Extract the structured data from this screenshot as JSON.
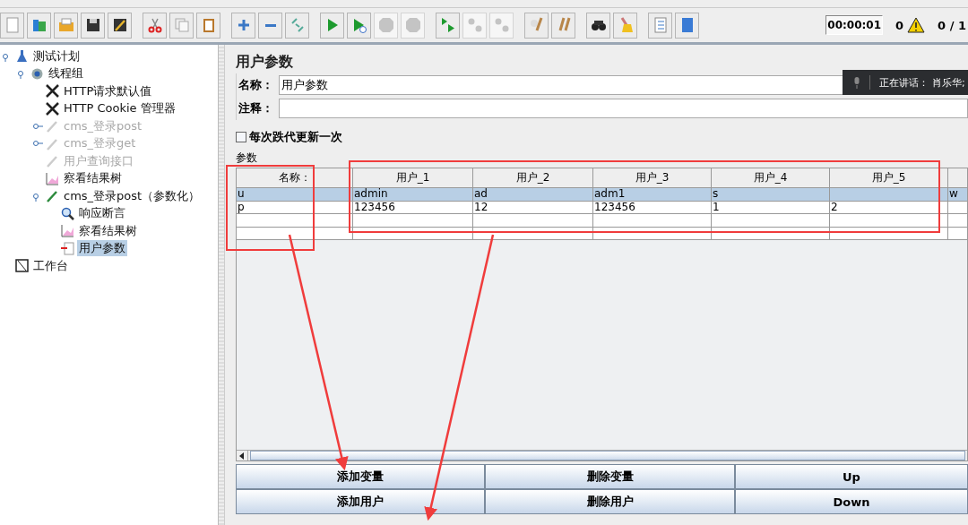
{
  "toolbar": {
    "groups": [
      [
        {
          "kind": "new",
          "disabled": false
        },
        {
          "kind": "templates",
          "disabled": false
        },
        {
          "kind": "open",
          "disabled": false
        },
        {
          "kind": "save",
          "disabled": false
        },
        {
          "kind": "save-as",
          "disabled": false
        }
      ],
      [
        {
          "kind": "cut",
          "disabled": false
        },
        {
          "kind": "copy",
          "disabled": false
        },
        {
          "kind": "paste",
          "disabled": false
        }
      ],
      [
        {
          "kind": "plus",
          "disabled": false
        },
        {
          "kind": "minus",
          "disabled": false
        },
        {
          "kind": "toggle",
          "disabled": false
        }
      ],
      [
        {
          "kind": "start",
          "disabled": false
        },
        {
          "kind": "start-no-pause",
          "disabled": false
        },
        {
          "kind": "stop",
          "disabled": true
        },
        {
          "kind": "shutdown",
          "disabled": true
        }
      ],
      [
        {
          "kind": "remote-start",
          "disabled": false
        },
        {
          "kind": "remote-stop",
          "disabled": true
        },
        {
          "kind": "remote-shutdown",
          "disabled": true
        }
      ],
      [
        {
          "kind": "clear",
          "disabled": false
        },
        {
          "kind": "clear-all",
          "disabled": false
        }
      ],
      [
        {
          "kind": "search",
          "disabled": false
        },
        {
          "kind": "reset-search",
          "disabled": false
        }
      ],
      [
        {
          "kind": "functions",
          "disabled": false
        },
        {
          "kind": "help",
          "disabled": false
        }
      ]
    ],
    "timer": "00:00:01",
    "warnings": "0",
    "threads": "0 / 1"
  },
  "tree": [
    {
      "label": "测试计划",
      "kind": "plan",
      "disabled": false,
      "selected": false,
      "expanded": true,
      "children": [
        {
          "label": "线程组",
          "kind": "gear",
          "disabled": false,
          "selected": false,
          "expanded": true,
          "children": [
            {
              "label": "HTTP请求默认值",
              "kind": "tools",
              "disabled": false,
              "selected": false
            },
            {
              "label": "HTTP Cookie 管理器",
              "kind": "tools",
              "disabled": false,
              "selected": false
            },
            {
              "label": "cms_登录post",
              "kind": "pipette",
              "disabled": true,
              "selected": false,
              "expanded": false
            },
            {
              "label": "cms_登录get",
              "kind": "pipette",
              "disabled": true,
              "selected": false,
              "expanded": false
            },
            {
              "label": "用户查询接口",
              "kind": "pipette",
              "disabled": true,
              "selected": false
            },
            {
              "label": "察看结果树",
              "kind": "graph",
              "disabled": false,
              "selected": false
            },
            {
              "label": "cms_登录post（参数化）",
              "kind": "pipette",
              "disabled": false,
              "selected": false,
              "expanded": true,
              "children": [
                {
                  "label": "响应断言",
                  "kind": "magnifier",
                  "disabled": false,
                  "selected": false
                },
                {
                  "label": "察看结果树",
                  "kind": "graph",
                  "disabled": false,
                  "selected": false
                },
                {
                  "label": "用户参数",
                  "kind": "doc",
                  "disabled": false,
                  "selected": true
                }
              ]
            }
          ]
        }
      ]
    },
    {
      "label": "工作台",
      "kind": "workbench",
      "disabled": false,
      "selected": false
    }
  ],
  "panel": {
    "title": "用户参数",
    "name_label": "名称：",
    "name_value": "用户参数",
    "comment_label": "注释：",
    "per_iteration": {
      "label": "每次跌代更新一次",
      "checked": false
    },
    "params_label": "参数",
    "table": {
      "columns": [
        "名称：",
        "用户_1",
        "用户_2",
        "用户_3",
        "用户_4",
        "用户_5",
        null
      ],
      "rows": [
        {
          "selected": true,
          "cells": [
            "u",
            "admin",
            "ad",
            "adm1",
            "s",
            null,
            "w"
          ]
        },
        {
          "selected": false,
          "cells": [
            "p",
            "123456",
            "12",
            "123456",
            "1",
            "2",
            null
          ]
        }
      ]
    },
    "buttons": [
      "添加变量",
      "删除变量",
      "Up",
      "添加用户",
      "删除用户",
      "Down"
    ]
  },
  "speaker_popup": {
    "label": "正在讲话：",
    "name": "肖乐华;"
  }
}
